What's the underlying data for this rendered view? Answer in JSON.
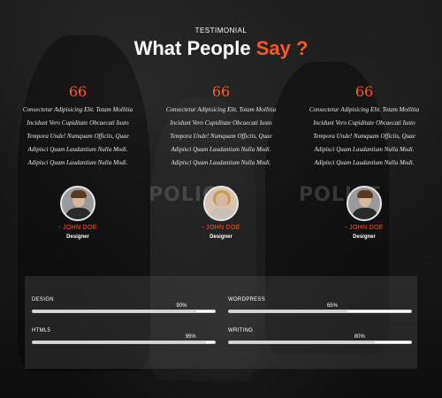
{
  "header": {
    "eyebrow": "TESTIMONIAL",
    "title_main": "What People",
    "title_accent": "Say ?"
  },
  "testimonials": [
    {
      "quote_mark": "66",
      "lines": [
        "Consectetur Adipisicing Elit. Totam Mollitia",
        "Incidunt Vero Cupiditate Obcaecati Iusto",
        "Tempora Unde! Numquam Officiis, Quae",
        "Adipisci Quam Laudantium Nulla Modi.",
        "Adipisci Quam Laudantium Nulla Modi."
      ],
      "name": "- JOHN DOE",
      "role": "Designer"
    },
    {
      "quote_mark": "66",
      "lines": [
        "Consectetur Adipisicing Elit. Totam Mollitia",
        "Incidunt Vero Cupiditate Obcaecati Iusto",
        "Tempora Unde! Numquam Officiis, Quae",
        "Adipisci Quam Laudantium Nulla Modi.",
        "Adipisci Quam Laudantium Nulla Modi."
      ],
      "name": "- JOHN DOE",
      "role": "Designer"
    },
    {
      "quote_mark": "66",
      "lines": [
        "Consectetur Adipisicing Elit. Totam Mollitia",
        "Incidunt Vero Cupiditate Obcaecati Iusto",
        "Tempora Unde! Numquam Officiis, Quae",
        "Adipisci Quam Laudantium Nulla Modi.",
        "Adipisci Quam Laudantium Nulla Modi."
      ],
      "name": "- JOHN DOE",
      "role": "Designer"
    }
  ],
  "background_text": [
    "POLICE",
    "POLICE"
  ],
  "skills": [
    {
      "label": "DESIGN",
      "percent_label": "90%",
      "value": 90
    },
    {
      "label": "WORDPRESS",
      "percent_label": "65%",
      "value": 65
    },
    {
      "label": "HTML5",
      "percent_label": "95%",
      "value": 95
    },
    {
      "label": "WRITING",
      "percent_label": "80%",
      "value": 80
    }
  ],
  "colors": {
    "accent": "#ff5a1f",
    "text": "#ffffff"
  }
}
